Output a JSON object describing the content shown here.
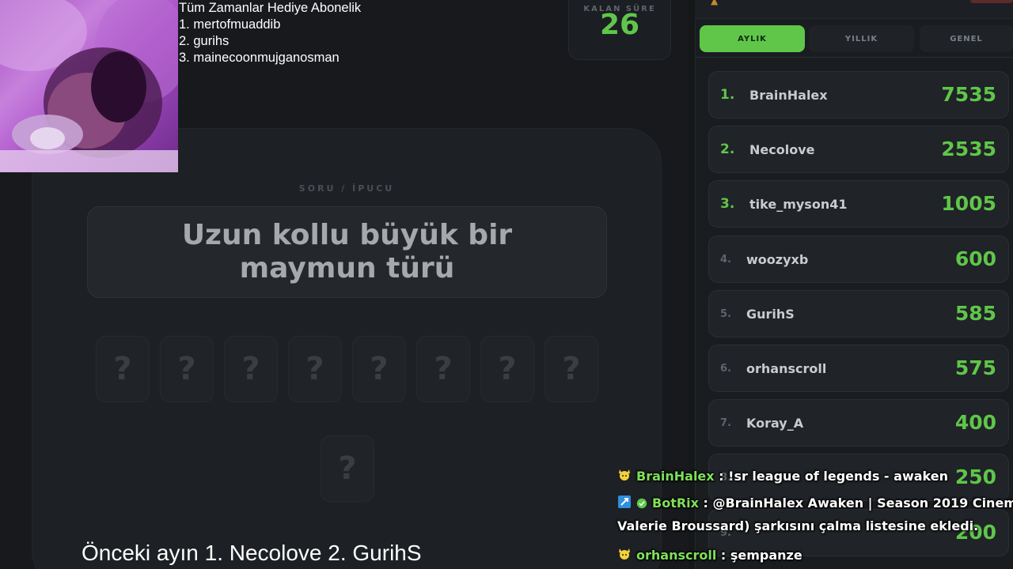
{
  "timer": {
    "label": "KALAN SÜRE",
    "value": "26"
  },
  "question": {
    "label": "SORU / İPUCU",
    "text": "Uzun kollu büyük bir maymun türü"
  },
  "tiles": {
    "row1": [
      "?",
      "?",
      "?",
      "?",
      "?",
      "?",
      "?",
      "?"
    ],
    "row2": [
      "?"
    ]
  },
  "donors": {
    "title": "Tüm Zamanlar Hediye  Abonelik",
    "entries": [
      "1. mertofmuaddib",
      "2. gurihs",
      "3. mainecoonmujganosman"
    ]
  },
  "previous_month": "Önceki ayın 1. Necolove 2. GurihS",
  "leaderboard": {
    "tabs": [
      {
        "label": "AYLIK",
        "active": true
      },
      {
        "label": "YILLIK",
        "active": false
      },
      {
        "label": "GENEL",
        "active": false
      }
    ],
    "rows": [
      {
        "rank": "1.",
        "name": "BrainHalex",
        "score": "7535"
      },
      {
        "rank": "2.",
        "name": "Necolove",
        "score": "2535"
      },
      {
        "rank": "3.",
        "name": "tike_myson41",
        "score": "1005"
      },
      {
        "rank": "4.",
        "name": "woozyxb",
        "score": "600"
      },
      {
        "rank": "5.",
        "name": "GurihS",
        "score": "585"
      },
      {
        "rank": "6.",
        "name": "orhanscroll",
        "score": "575"
      },
      {
        "rank": "7.",
        "name": "Koray_A",
        "score": "400"
      },
      {
        "rank": "8.",
        "name": "",
        "score": "250"
      },
      {
        "rank": "9.",
        "name": "",
        "score": "200"
      }
    ]
  },
  "chat": [
    {
      "user": "BrainHalex",
      "text": " : !sr league of legends - awaken"
    },
    {
      "user": "BotRix",
      "text": " : @BrainHalex Awaken | Season 2019 Cinem",
      "continuation": "Valerie Broussard) şarkısını çalma listesine ekledi."
    },
    {
      "user": "orhanscroll",
      "text": " : şempanze"
    }
  ],
  "colors": {
    "accent": "#5fc64a",
    "background": "#17191c",
    "panel": "#1a1d20"
  },
  "icons": {
    "trophy": "trophy-icon",
    "pikachu_badge": "pikachu-badge-icon",
    "bot_badge": "bot-badge-icon",
    "verified_badge": "verified-badge-icon"
  }
}
